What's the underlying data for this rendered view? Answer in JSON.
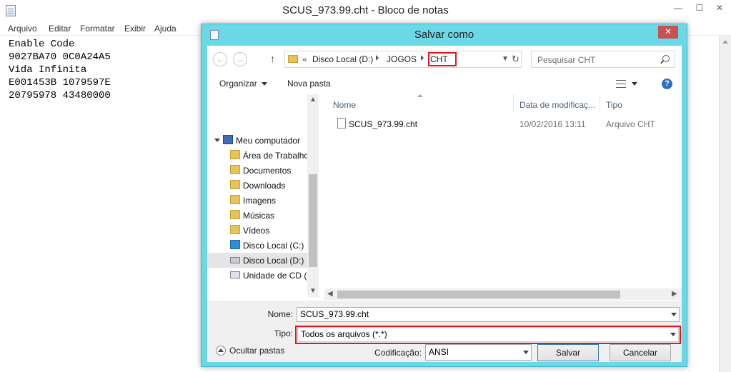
{
  "notepad": {
    "title": "SCUS_973.99.cht - Bloco de notas",
    "menu": [
      "Arquivo",
      "Editar",
      "Formatar",
      "Exibir",
      "Ajuda"
    ],
    "content_lines": [
      "Enable Code",
      "9027BA70 0C0A24A5",
      "",
      "Vida Infinita",
      "E001453B 1079597E",
      "20795978 43480000"
    ]
  },
  "dialog": {
    "title": "Salvar como",
    "address": {
      "overflow": "«",
      "segments": [
        "Disco Local (D:)",
        "JOGOS",
        "CHT"
      ]
    },
    "search_placeholder": "Pesquisar CHT",
    "toolbar": {
      "organize": "Organizar",
      "new_folder": "Nova pasta"
    },
    "nav_items": [
      "Meu computador",
      "Área de Trabalho",
      "Documentos",
      "Downloads",
      "Imagens",
      "Músicas",
      "Vídeos",
      "Disco Local (C:)",
      "Disco Local (D:)",
      "Unidade de CD (F"
    ],
    "selected_nav": "Disco Local (D:)",
    "columns": {
      "name": "Nome",
      "modified": "Data de modificaç...",
      "type": "Tipo"
    },
    "files": [
      {
        "name": "SCUS_973.99.cht",
        "modified": "10/02/2016 13:11",
        "type": "Arquivo CHT"
      }
    ],
    "name_label": "Nome:",
    "name_value": "SCUS_973.99.cht",
    "type_label": "Tipo:",
    "type_value": "Todos os arquivos  (*.*)",
    "encoding_label": "Codificação:",
    "encoding_value": "ANSI",
    "hide_folders": "Ocultar pastas",
    "save": "Salvar",
    "cancel": "Cancelar",
    "close_glyph": "✕",
    "highlight_color": "#e0171f",
    "frame_color": "#6bd8e8"
  }
}
